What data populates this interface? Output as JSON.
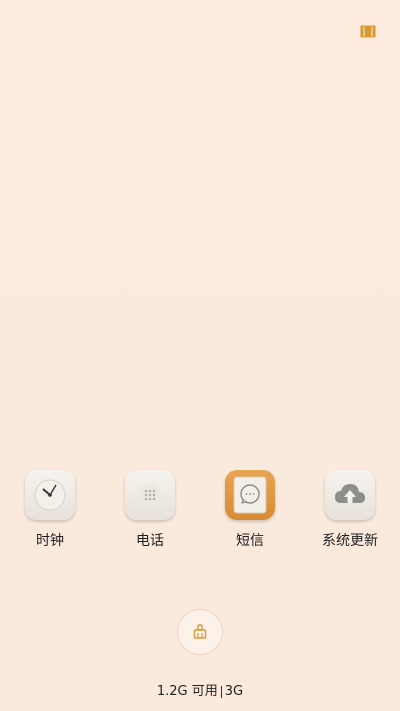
{
  "recent_apps": [
    {
      "name": "时钟",
      "icon": "clock-icon"
    },
    {
      "name": "电话",
      "icon": "phone-keypad-icon"
    },
    {
      "name": "短信",
      "icon": "message-bubble-icon"
    },
    {
      "name": "系统更新",
      "icon": "cloud-upload-icon"
    }
  ],
  "memory": {
    "available": "1.2G 可用",
    "total": "3G"
  },
  "colors": {
    "background": "#fbeadd",
    "accent": "#d89a33"
  }
}
